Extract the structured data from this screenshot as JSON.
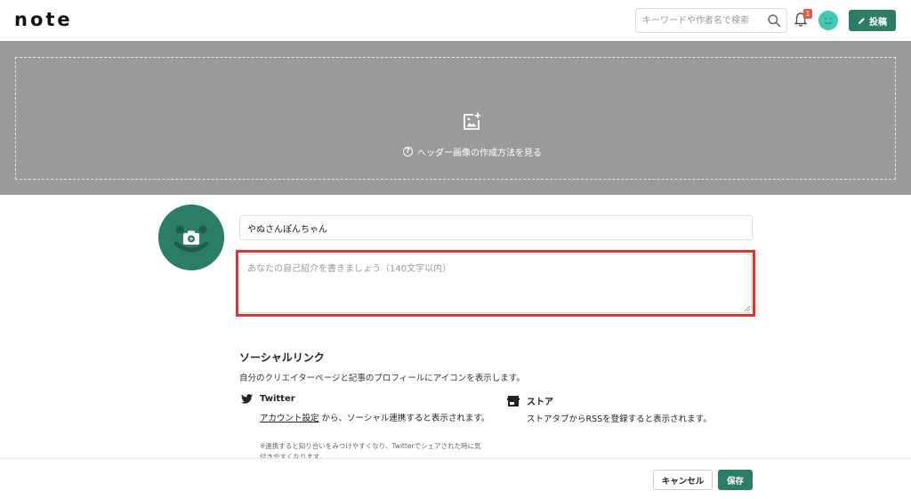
{
  "header": {
    "logo": "note",
    "search_placeholder": "キーワードや作者名で検索",
    "notification_count": "1",
    "post_label": "投稿"
  },
  "header_image": {
    "help_text": "ヘッダー画像の作成方法を見る"
  },
  "profile": {
    "name_value": "やぬさんぽんちゃん",
    "bio_placeholder": "あなたの自己紹介を書きましょう（140文字以内）"
  },
  "social": {
    "title": "ソーシャルリンク",
    "description": "自分のクリエイターページと記事のプロフィールにアイコンを表示します。",
    "twitter": {
      "label": "Twitter",
      "link_text": "アカウント設定",
      "text_after_link": "から、ソーシャル連携すると表示されます。",
      "note": "※連携すると知り合いをみつけやすくなり、Twitterでシェアされた時に気付きやすくなります。"
    },
    "store": {
      "label": "ストア",
      "text": "ストアタブからRSSを登録すると表示されます。"
    }
  },
  "footer": {
    "cancel_label": "キャンセル",
    "save_label": "保存"
  },
  "colors": {
    "brand_green": "#2c7d68",
    "header_gray": "#9a9a9a",
    "highlight_red": "#ec2c2f",
    "badge_red": "#e25c45"
  }
}
